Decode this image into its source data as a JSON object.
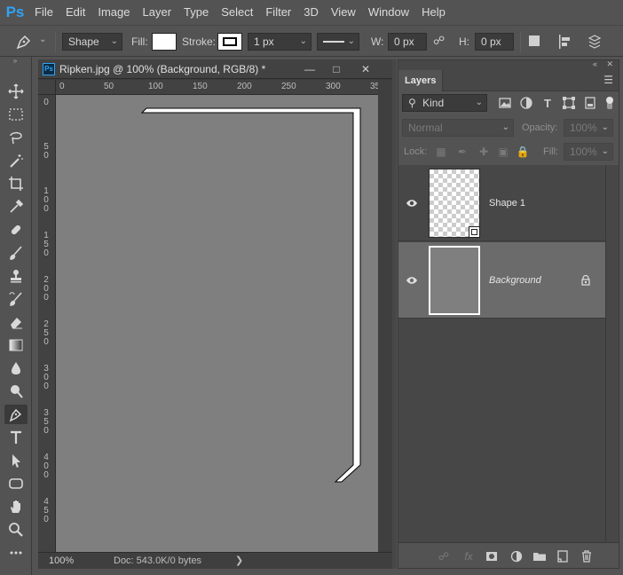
{
  "app": {
    "logo": "Ps"
  },
  "menu": [
    "File",
    "Edit",
    "Image",
    "Layer",
    "Type",
    "Select",
    "Filter",
    "3D",
    "View",
    "Window",
    "Help"
  ],
  "options_bar": {
    "tool_icon": "pen-icon",
    "mode": "Shape",
    "fill_label": "Fill:",
    "fill_color": "#ffffff",
    "stroke_label": "Stroke:",
    "stroke_color": "#000000",
    "stroke_width": "1 px",
    "w_label": "W:",
    "w_value": "0 px",
    "h_label": "H:",
    "h_value": "0 px"
  },
  "tools": [
    "move-tool-icon",
    "marquee-tool-icon",
    "lasso-tool-icon",
    "magic-wand-tool-icon",
    "crop-tool-icon",
    "eyedropper-tool-icon",
    "healing-brush-tool-icon",
    "brush-tool-icon",
    "clone-stamp-tool-icon",
    "history-brush-tool-icon",
    "eraser-tool-icon",
    "gradient-tool-icon",
    "blur-tool-icon",
    "dodge-tool-icon",
    "pen-tool-icon",
    "type-tool-icon",
    "path-selection-tool-icon",
    "rectangle-tool-icon",
    "hand-tool-icon",
    "zoom-tool-icon",
    "more-tools-icon"
  ],
  "document": {
    "title": "Ripken.jpg @ 100% (Background, RGB/8) *",
    "ruler_h_labels": [
      "0",
      "50",
      "100",
      "150",
      "200",
      "250",
      "300",
      "35"
    ],
    "ruler_v_labels": [
      "0",
      "5 0",
      "1 0 0",
      "1 5 0",
      "2 0 0",
      "2 5 0",
      "3 0 0",
      "3 5 0",
      "4 0 0",
      "4 5 0"
    ],
    "canvas_color": "#7f7f7f",
    "zoom": "100%",
    "doc_info": "Doc: 543.0K/0 bytes",
    "status_arrow": "❯"
  },
  "layers_panel": {
    "tab": "Layers",
    "filter_kind": "Kind",
    "blend_mode": "Normal",
    "opacity_label": "Opacity:",
    "opacity_value": "100%",
    "lock_label": "Lock:",
    "fill_label": "Fill:",
    "fill_value": "100%",
    "layers": [
      {
        "name": "Shape 1",
        "visible": true,
        "selected": false,
        "locked": false
      },
      {
        "name": "Background",
        "visible": true,
        "selected": true,
        "locked": true
      }
    ]
  }
}
